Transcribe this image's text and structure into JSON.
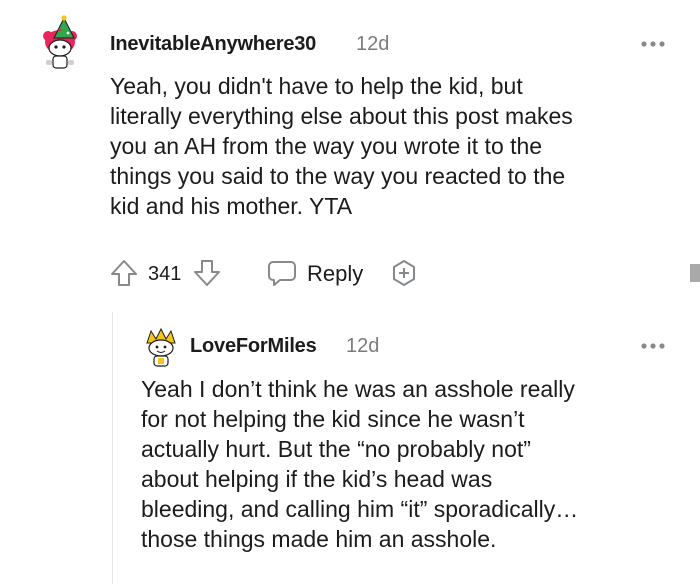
{
  "comment": {
    "username": "InevitableAnywhere30",
    "age": "12d",
    "body_lines": [
      "Yeah, you didn't have to help the kid, but",
      "literally everything else about this post makes",
      "you an AH from the way you wrote it to the",
      "things you said to the way you reacted to the",
      "kid and his mother. YTA"
    ],
    "score": "341",
    "reply_label": "Reply",
    "icons": {
      "avatar": "snoo-avatar-christmas-tree",
      "upvote": "upvote-arrow-icon",
      "downvote": "downvote-arrow-icon",
      "reply": "chat-bubble-icon",
      "award": "award-plus-icon",
      "more": "more-dots-icon"
    }
  },
  "reply": {
    "username": "LoveForMiles",
    "age": "12d",
    "body_lines": [
      "Yeah I don’t think he was an asshole really",
      "for not helping the kid since he wasn’t",
      "actually hurt. But the “no probably not”",
      "about helping if the kid’s head was",
      "bleeding, and calling him “it” sporadically…",
      "those things made him an asshole."
    ],
    "icons": {
      "avatar": "snoo-avatar-yellow-hair",
      "more": "more-dots-icon"
    }
  },
  "colors": {
    "text": "#1c1c1c",
    "meta": "#7c7c7c",
    "icon": "#878a8c",
    "thread_line": "#e6e6e6"
  }
}
